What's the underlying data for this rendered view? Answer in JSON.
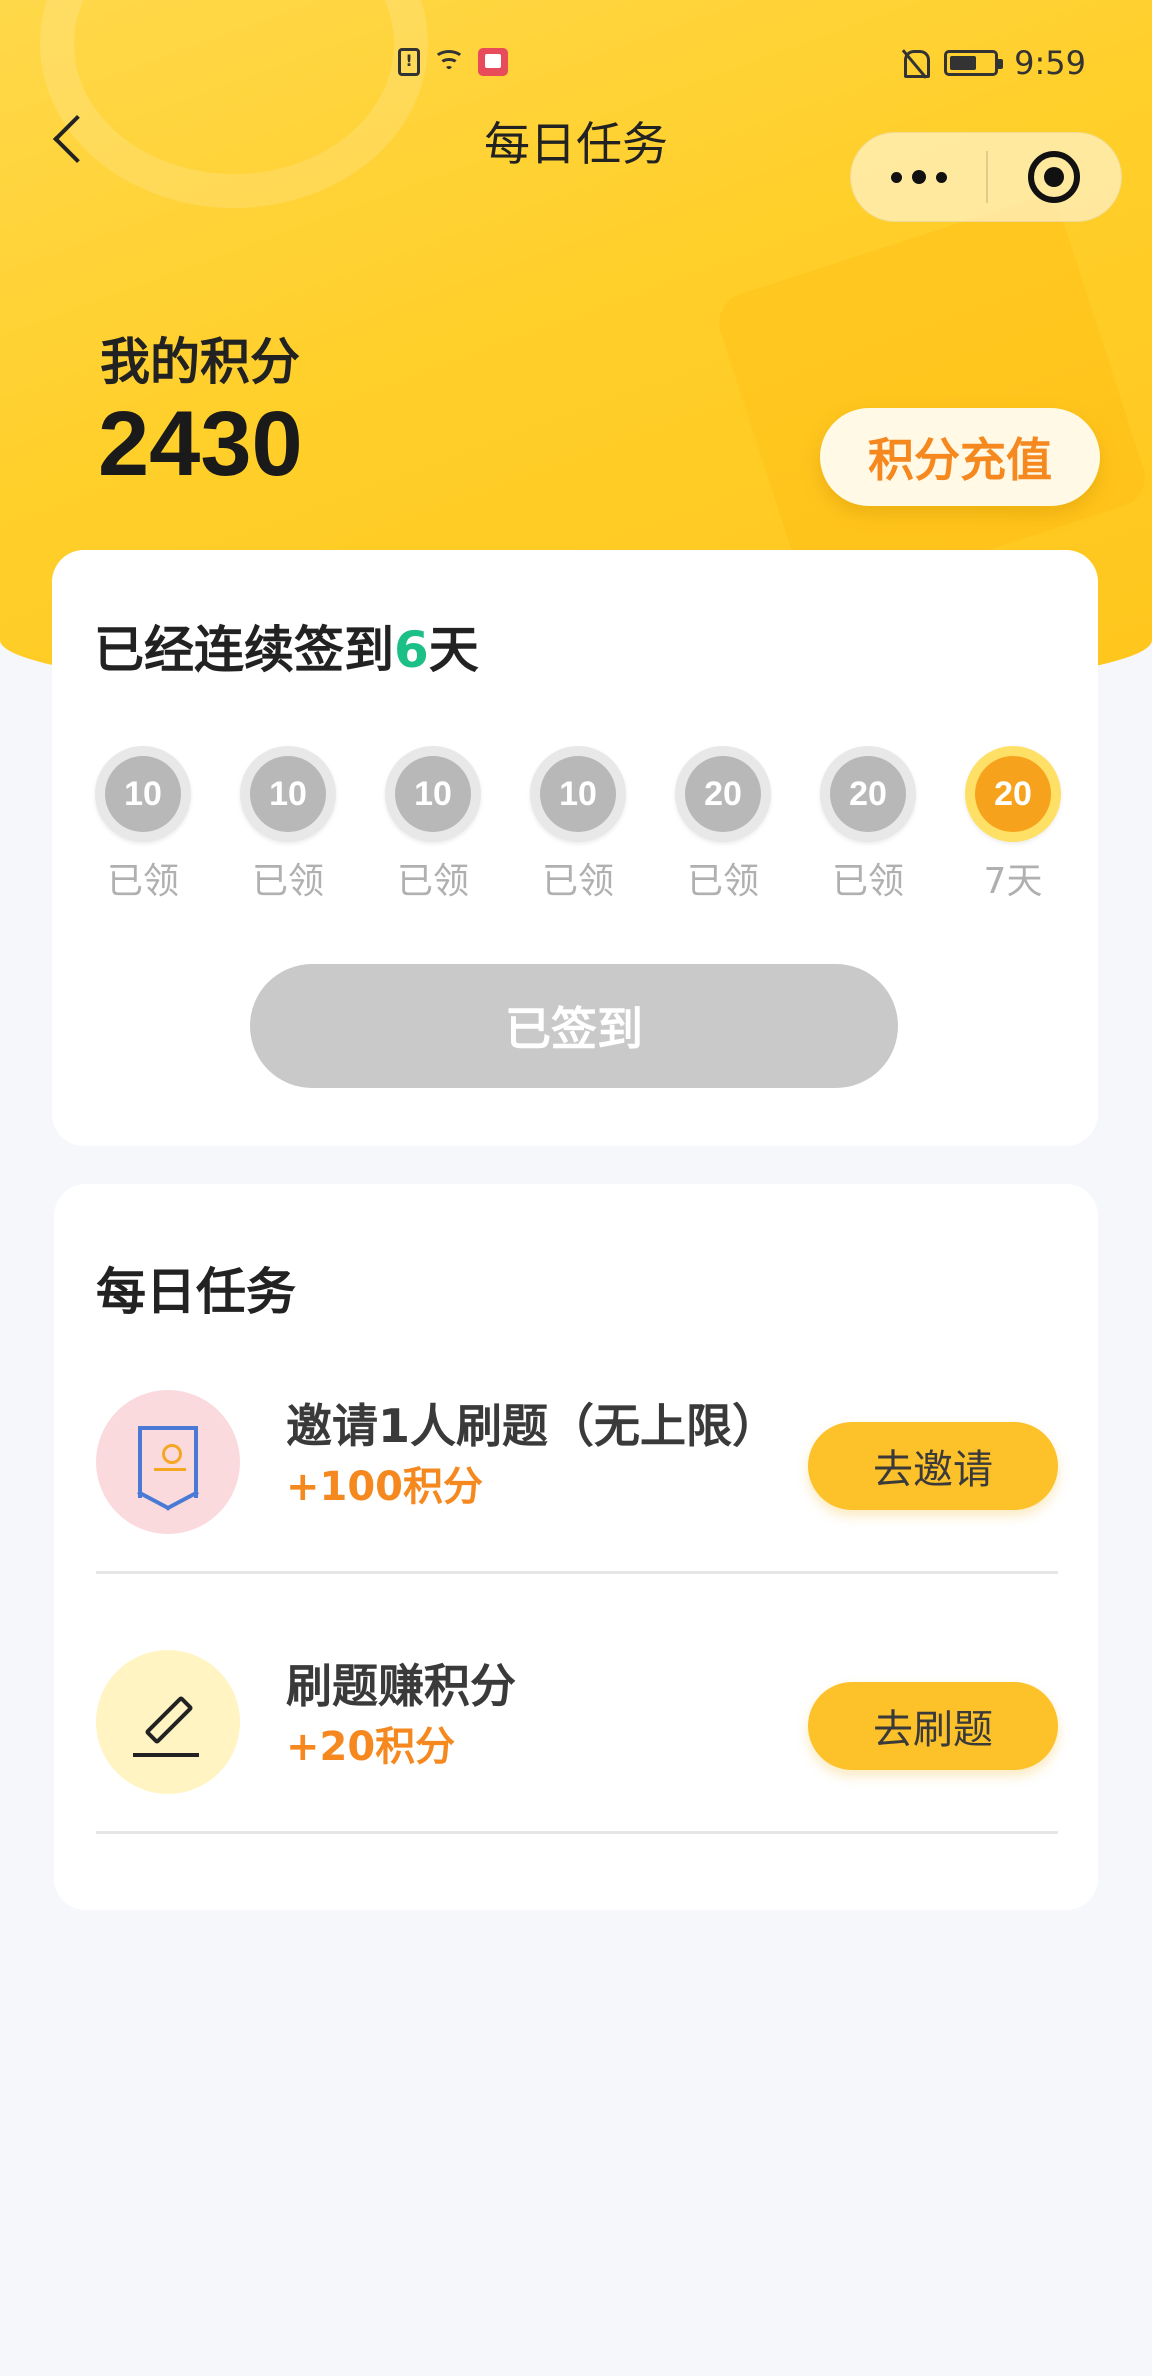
{
  "status_bar": {
    "time": "9:59",
    "sim_glyph": "!"
  },
  "nav": {
    "title": "每日任务"
  },
  "points": {
    "label": "我的积分",
    "value": "2430",
    "recharge_label": "积分充值"
  },
  "signin": {
    "streak_prefix": "已经连续签到",
    "streak_days": "6",
    "streak_suffix": "天",
    "days": [
      {
        "points": "10",
        "label": "已领",
        "claimed": true
      },
      {
        "points": "10",
        "label": "已领",
        "claimed": true
      },
      {
        "points": "10",
        "label": "已领",
        "claimed": true
      },
      {
        "points": "10",
        "label": "已领",
        "claimed": true
      },
      {
        "points": "20",
        "label": "已领",
        "claimed": true
      },
      {
        "points": "20",
        "label": "已领",
        "claimed": true
      },
      {
        "points": "20",
        "label": "7天",
        "claimed": false
      }
    ],
    "button_label": "已签到"
  },
  "tasks": {
    "title": "每日任务",
    "items": [
      {
        "name": "邀请1人刷题（无上限）",
        "reward": "+100积分",
        "button": "去邀请",
        "icon": "badge-icon"
      },
      {
        "name": "刷题赚积分",
        "reward": "+20积分",
        "button": "去刷题",
        "icon": "pen-icon"
      }
    ]
  },
  "colors": {
    "accent_yellow": "#fdc12a",
    "reward_orange": "#f5891f",
    "streak_green": "#1cbf85"
  }
}
